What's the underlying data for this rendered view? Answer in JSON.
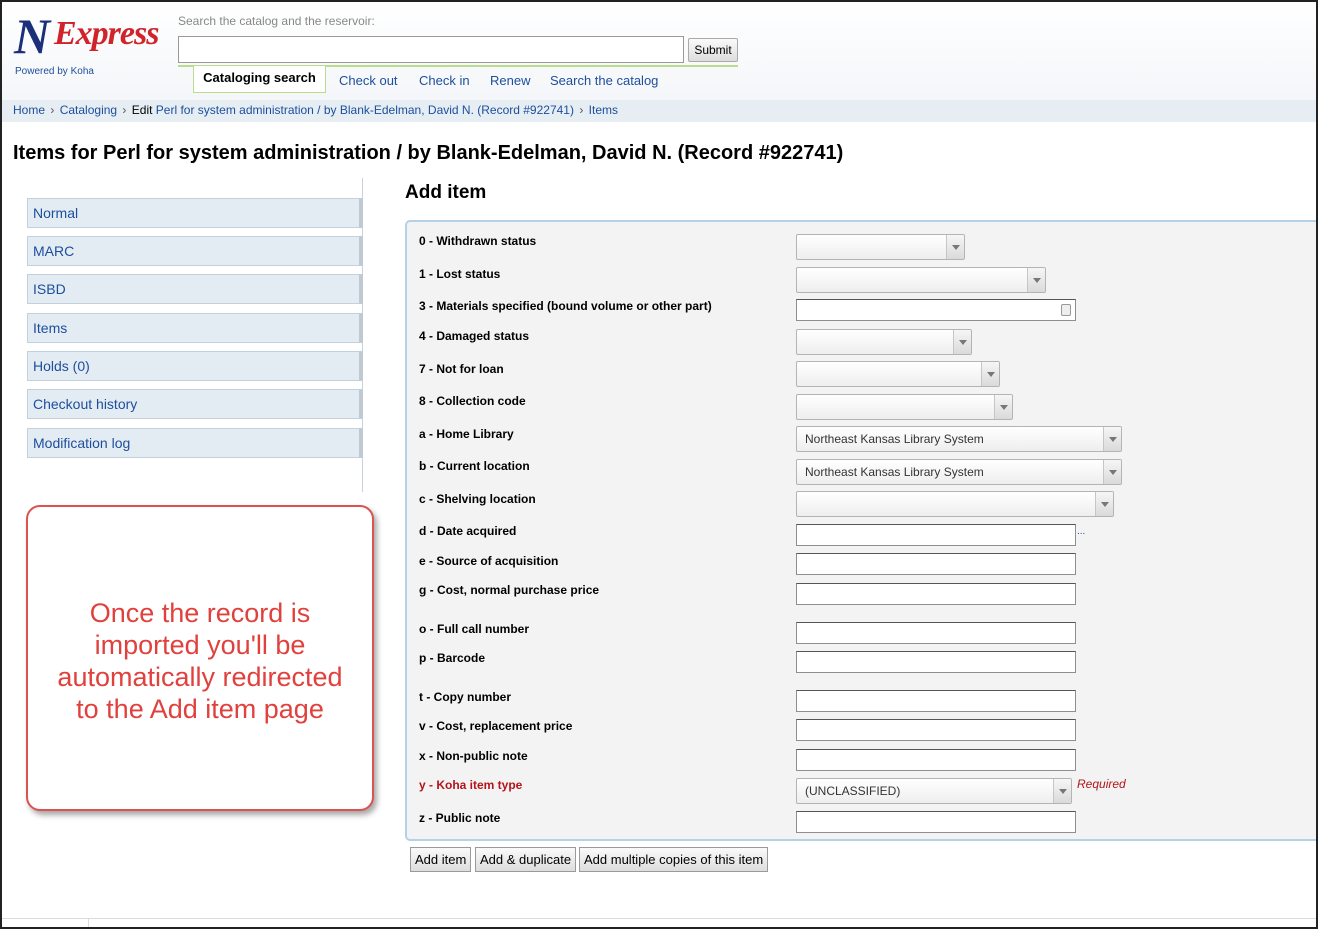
{
  "header": {
    "logo_primary": "N",
    "logo_secondary": "Express",
    "powered_by": "Powered by Koha",
    "search_label": "Search the catalog and the reservoir:",
    "search_value": "",
    "submit_label": "Submit",
    "active_tab": "Cataloging search",
    "nav": [
      "Check out",
      "Check in",
      "Renew",
      "Search the catalog"
    ]
  },
  "breadcrumb": {
    "home": "Home",
    "cataloging": "Cataloging",
    "edit_prefix": "Edit",
    "record": "Perl for system administration / by Blank-Edelman, David N. (Record #922741)",
    "items": "Items",
    "separator": "›"
  },
  "page_title": "Items for Perl for system administration / by Blank-Edelman, David N. (Record #922741)",
  "sidebar": {
    "items": [
      {
        "label": "Normal"
      },
      {
        "label": "MARC"
      },
      {
        "label": "ISBD"
      },
      {
        "label": "Items"
      },
      {
        "label": "Holds (0)"
      },
      {
        "label": "Checkout history"
      },
      {
        "label": "Modification log"
      }
    ]
  },
  "callout": {
    "lines": [
      "Once the record is",
      "imported you'll be",
      "automatically redirected",
      "to the Add item page"
    ],
    "color": "#e0413c"
  },
  "form": {
    "heading": "Add item",
    "fields": [
      {
        "label": "0 - Withdrawn status",
        "type": "select",
        "value": ""
      },
      {
        "label": "1 - Lost status",
        "type": "select",
        "value": ""
      },
      {
        "label": "3 - Materials specified (bound volume or other part)",
        "type": "input",
        "value": ""
      },
      {
        "label": "4 - Damaged status",
        "type": "select",
        "value": ""
      },
      {
        "label": "7 - Not for loan",
        "type": "select",
        "value": ""
      },
      {
        "label": "8 - Collection code",
        "type": "select",
        "value": ""
      },
      {
        "label": "a - Home Library",
        "type": "select",
        "value": "Northeast Kansas Library System"
      },
      {
        "label": "b - Current location",
        "type": "select",
        "value": "Northeast Kansas Library System"
      },
      {
        "label": "c - Shelving location",
        "type": "select",
        "value": ""
      },
      {
        "label": "d - Date acquired",
        "type": "input",
        "value": "",
        "extra": "..."
      },
      {
        "label": "e - Source of acquisition",
        "type": "input",
        "value": ""
      },
      {
        "label": "g - Cost, normal purchase price",
        "type": "input",
        "value": ""
      },
      {
        "label": "o - Full call number",
        "type": "input",
        "value": ""
      },
      {
        "label": "p - Barcode",
        "type": "input",
        "value": ""
      },
      {
        "label": "t - Copy number",
        "type": "input",
        "value": ""
      },
      {
        "label": "v - Cost, replacement price",
        "type": "input",
        "value": ""
      },
      {
        "label": "x - Non-public note",
        "type": "input",
        "value": ""
      },
      {
        "label": "y - Koha item type",
        "type": "select",
        "value": "(UNCLASSIFIED)",
        "required": true
      },
      {
        "label": "z - Public note",
        "type": "input",
        "value": ""
      }
    ],
    "required_label": "Required",
    "required_color": "#b3141a",
    "buttons": [
      "Add item",
      "Add & duplicate",
      "Add multiple copies of this item"
    ]
  }
}
